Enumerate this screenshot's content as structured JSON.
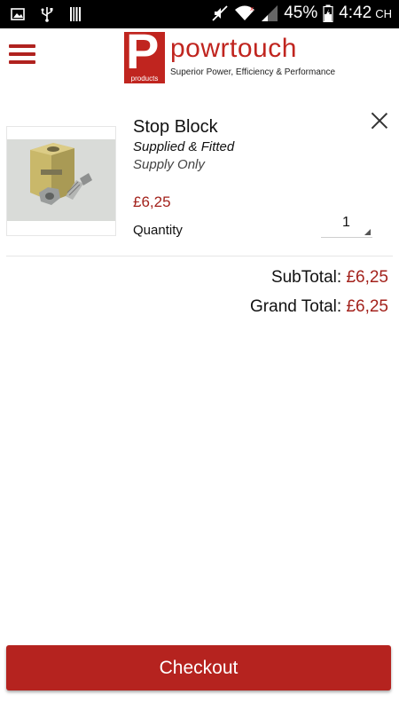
{
  "status_bar": {
    "battery_percent": "45%",
    "time": "4:42",
    "time_suffix": "CH",
    "icons": [
      "image-icon",
      "usb-icon",
      "barcode-icon",
      "mute-icon",
      "wifi-icon",
      "signal-icon",
      "battery-icon"
    ]
  },
  "header": {
    "logo_small_text": "powr",
    "logo_letter": "P",
    "logo_products": "products",
    "logo_word_light": "powr",
    "logo_word_bold": "touch",
    "tagline": "Superior Power, Efficiency & Performance",
    "brand_color": "#c0251f"
  },
  "cart": {
    "items": [
      {
        "name": "Stop Block",
        "option_1": "Supplied & Fitted",
        "option_2": "Supply Only",
        "price": "£6,25",
        "quantity_label": "Quantity",
        "quantity": "1"
      }
    ]
  },
  "totals": {
    "subtotal_label": "SubTotal:",
    "subtotal_value": "£6,25",
    "grand_total_label": "Grand Total:",
    "grand_total_value": "£6,25"
  },
  "checkout": {
    "label": "Checkout",
    "color": "#b5231f"
  }
}
